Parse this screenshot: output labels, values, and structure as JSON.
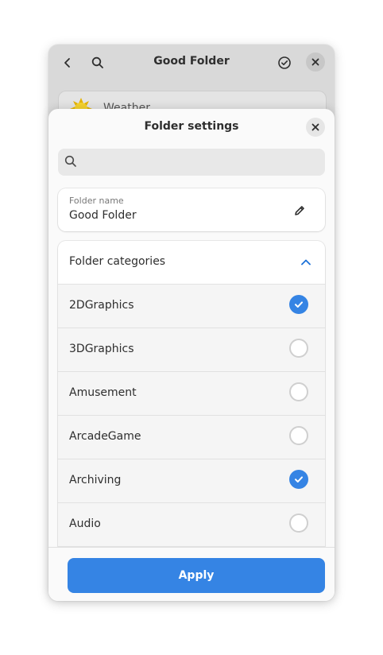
{
  "background_window": {
    "title": "Good Folder",
    "row_label": "Weather"
  },
  "dialog": {
    "title": "Folder settings",
    "search_placeholder": "",
    "folder_name": {
      "label": "Folder name",
      "value": "Good Folder"
    },
    "categories": {
      "header": "Folder categories",
      "items": [
        {
          "label": "2DGraphics",
          "checked": true
        },
        {
          "label": "3DGraphics",
          "checked": false
        },
        {
          "label": "Amusement",
          "checked": false
        },
        {
          "label": "ArcadeGame",
          "checked": false
        },
        {
          "label": "Archiving",
          "checked": true
        },
        {
          "label": "Audio",
          "checked": false
        }
      ]
    },
    "apply_label": "Apply"
  },
  "colors": {
    "accent": "#3584e4",
    "background_window": "#d9d9d9",
    "dialog": "#fafafa"
  }
}
